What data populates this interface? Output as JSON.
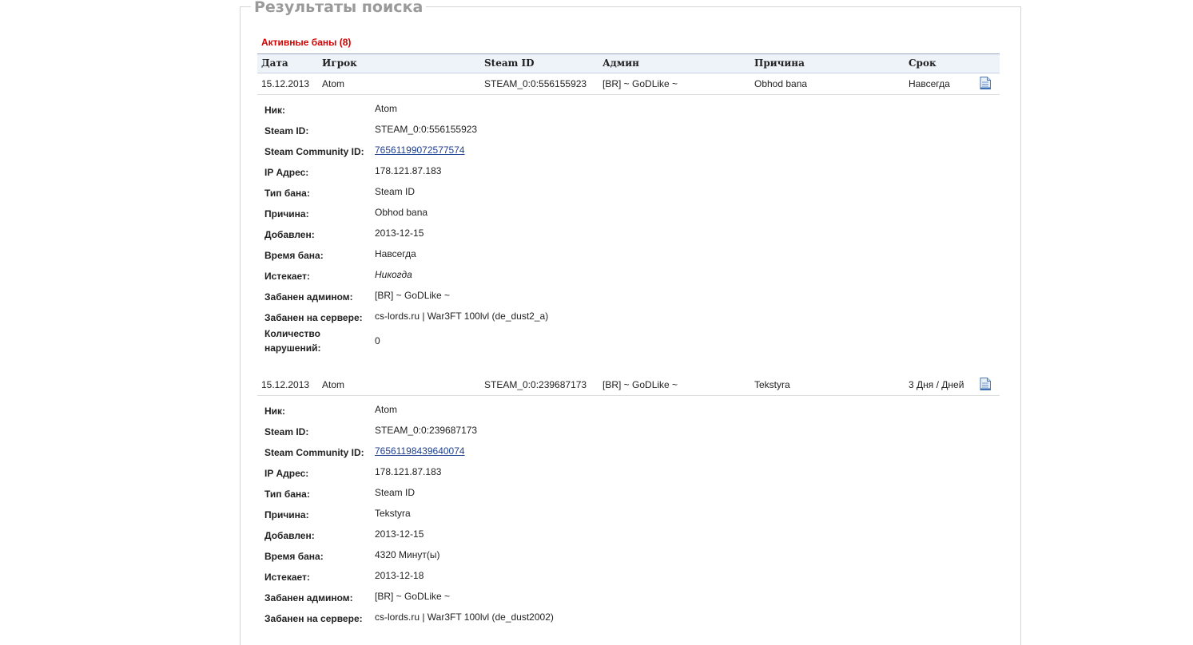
{
  "panel": {
    "legend": "Результаты поиска",
    "section_title": "Активные баны (8)"
  },
  "columns": {
    "date": "Дата",
    "player": "Игрок",
    "steam_id": "Steam ID",
    "admin": "Админ",
    "reason": "Причина",
    "term": "Срок"
  },
  "labels": {
    "nick": "Ник:",
    "steam_id": "Steam ID:",
    "community_id": "Steam Community ID:",
    "ip": "IP Адрес:",
    "ban_type": "Тип бана:",
    "reason": "Причина:",
    "added": "Добавлен:",
    "ban_time": "Время бана:",
    "expires": "Истекает:",
    "banned_by": "Забанен админом:",
    "banned_on_server": "Забанен на сервере:",
    "violations": "Количество нарушений:"
  },
  "bans": [
    {
      "row": {
        "date": "15.12.2013",
        "player": "Atom",
        "steam_id": "STEAM_0:0:556155923",
        "admin": "[BR] ~ GoDLike ~",
        "reason": "Obhod bana",
        "term": "Навсегда",
        "icon": "document-icon"
      },
      "details": {
        "nick": "Atom",
        "steam_id": "STEAM_0:0:556155923",
        "community_id": "76561199072577574",
        "ip": "178.121.87.183",
        "ban_type": "Steam ID",
        "reason": "Obhod bana",
        "added": "2013-12-15",
        "ban_time": "Навсегда",
        "expires": "Никогда",
        "banned_by": "[BR] ~ GoDLike ~",
        "banned_on_server": "cs-lords.ru | War3FT 100lvl (de_dust2_a)",
        "violations": "0"
      }
    },
    {
      "row": {
        "date": "15.12.2013",
        "player": "Atom",
        "steam_id": "STEAM_0:0:239687173",
        "admin": "[BR] ~ GoDLike ~",
        "reason": "Tekstyra",
        "term": "3 Дня / Дней",
        "icon": "document-icon"
      },
      "details": {
        "nick": "Atom",
        "steam_id": "STEAM_0:0:239687173",
        "community_id": "76561198439640074",
        "ip": "178.121.87.183",
        "ban_type": "Steam ID",
        "reason": "Tekstyra",
        "added": "2013-12-15",
        "ban_time": "4320 Минут(ы)",
        "expires": "2013-12-18",
        "banned_by": "[BR] ~ GoDLike ~",
        "banned_on_server": "cs-lords.ru | War3FT 100lvl (de_dust2002)"
      }
    }
  ]
}
